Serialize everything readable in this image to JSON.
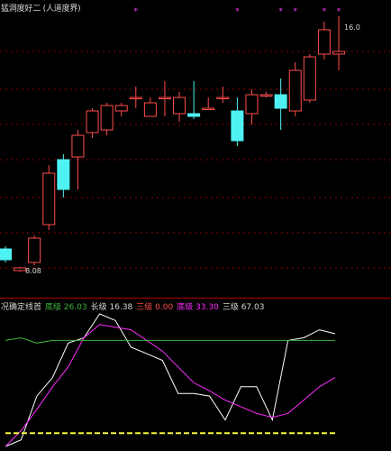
{
  "window": {
    "title": "猛洞度好二 (人道度界)"
  },
  "colors": {
    "background": "#000000",
    "grid": "#8b0000",
    "divider": "#b00000",
    "up_candle": "#ff4d4d",
    "down_candle": "#4ff2f2",
    "marker": "#ff44ff",
    "ma_magenta": "#ff2bff",
    "ma_white": "#ffffff",
    "ma_green": "#3fb83f",
    "base_yellow": "#f5f53c",
    "label_text": "#d8d8d8"
  },
  "chart_data": [
    {
      "type": "candlestick",
      "title": "猛洞度好二 (人道度界)",
      "ylim": [
        0,
        100
      ],
      "grid": "dotted horizontal",
      "annotations": [
        {
          "text": "16.0",
          "at_index": 23,
          "value": 96
        },
        {
          "text": "8.08",
          "at_index": 1,
          "value": 6
        }
      ],
      "top_markers": [
        9,
        16,
        19,
        20,
        22,
        23
      ],
      "candles": [
        {
          "open": 10,
          "close": 14,
          "high": 15,
          "low": 9,
          "dir": "down"
        },
        {
          "open": 6,
          "close": 7,
          "high": 7.5,
          "low": 5.5,
          "dir": "up"
        },
        {
          "open": 9,
          "close": 18,
          "high": 19,
          "low": 8,
          "dir": "up"
        },
        {
          "open": 23,
          "close": 42,
          "high": 45,
          "low": 21,
          "dir": "up"
        },
        {
          "open": 47,
          "close": 36,
          "high": 49,
          "low": 33,
          "dir": "down"
        },
        {
          "open": 48,
          "close": 56,
          "high": 58,
          "low": 36,
          "dir": "up"
        },
        {
          "open": 57,
          "close": 65,
          "high": 66,
          "low": 55,
          "dir": "up"
        },
        {
          "open": 58,
          "close": 67,
          "high": 68,
          "low": 56,
          "dir": "up"
        },
        {
          "open": 65,
          "close": 67,
          "high": 68,
          "low": 63,
          "dir": "up"
        },
        {
          "open": 70,
          "close": 70,
          "high": 74,
          "low": 66,
          "dir": "up"
        },
        {
          "open": 63,
          "close": 68,
          "high": 70,
          "low": 63,
          "dir": "up"
        },
        {
          "open": 70,
          "close": 70,
          "high": 76,
          "low": 63,
          "dir": "up"
        },
        {
          "open": 64,
          "close": 70,
          "high": 72,
          "low": 61,
          "dir": "up"
        },
        {
          "open": 63,
          "close": 64,
          "high": 76,
          "low": 62,
          "dir": "down"
        },
        {
          "open": 66,
          "close": 66,
          "high": 70,
          "low": 66,
          "dir": "up"
        },
        {
          "open": 70,
          "close": 70,
          "high": 74,
          "low": 68,
          "dir": "up"
        },
        {
          "open": 65,
          "close": 54,
          "high": 70,
          "low": 52,
          "dir": "down"
        },
        {
          "open": 64,
          "close": 71,
          "high": 73,
          "low": 60,
          "dir": "up"
        },
        {
          "open": 71,
          "close": 71,
          "high": 72,
          "low": 70,
          "dir": "up"
        },
        {
          "open": 66,
          "close": 71,
          "high": 77,
          "low": 58,
          "dir": "down"
        },
        {
          "open": 65,
          "close": 80,
          "high": 83,
          "low": 63,
          "dir": "up"
        },
        {
          "open": 69,
          "close": 85,
          "high": 86,
          "low": 68,
          "dir": "up"
        },
        {
          "open": 86,
          "close": 95,
          "high": 98,
          "low": 84,
          "dir": "up"
        },
        {
          "open": 87,
          "close": 86,
          "high": 100,
          "low": 80,
          "dir": "up"
        }
      ]
    },
    {
      "type": "line",
      "legend": [
        {
          "label": "况确定线首",
          "value": "",
          "color": "#d8d8d8"
        },
        {
          "label": "底级",
          "value": "26.03",
          "color": "#3fb83f"
        },
        {
          "label": "长级",
          "value": "16.38",
          "color": "#d8d8d8"
        },
        {
          "label": "三级",
          "value": "0.00",
          "color": "#ff4d4d"
        },
        {
          "label": "底级",
          "value": "33.30",
          "color": "#ff2bff"
        },
        {
          "label": "三级",
          "value": "67.03",
          "color": "#d8d8d8"
        }
      ],
      "ylim": [
        0,
        100
      ],
      "series": [
        {
          "color": "#ffffff",
          "values": [
            0,
            5,
            38,
            52,
            78,
            82,
            100,
            95,
            75,
            70,
            65,
            40,
            40,
            38,
            20,
            45,
            45,
            20,
            80,
            82,
            88,
            85
          ]
        },
        {
          "color": "#ff2bff",
          "values": [
            0,
            12,
            28,
            45,
            60,
            82,
            92,
            90,
            88,
            80,
            72,
            60,
            48,
            42,
            35,
            30,
            25,
            22,
            25,
            35,
            45,
            52
          ]
        },
        {
          "color": "#3fb83f",
          "values": [
            80,
            82,
            78,
            80,
            80,
            80,
            80,
            80,
            80,
            80,
            80,
            80,
            80,
            80,
            80,
            80,
            80,
            80,
            80,
            80,
            80,
            80
          ]
        },
        {
          "color": "#f5f53c",
          "values": [
            10,
            10,
            10,
            10,
            10,
            10,
            10,
            10,
            10,
            10,
            10,
            10,
            10,
            10,
            10,
            10,
            10,
            10,
            10,
            10,
            10,
            10
          ]
        }
      ]
    }
  ]
}
